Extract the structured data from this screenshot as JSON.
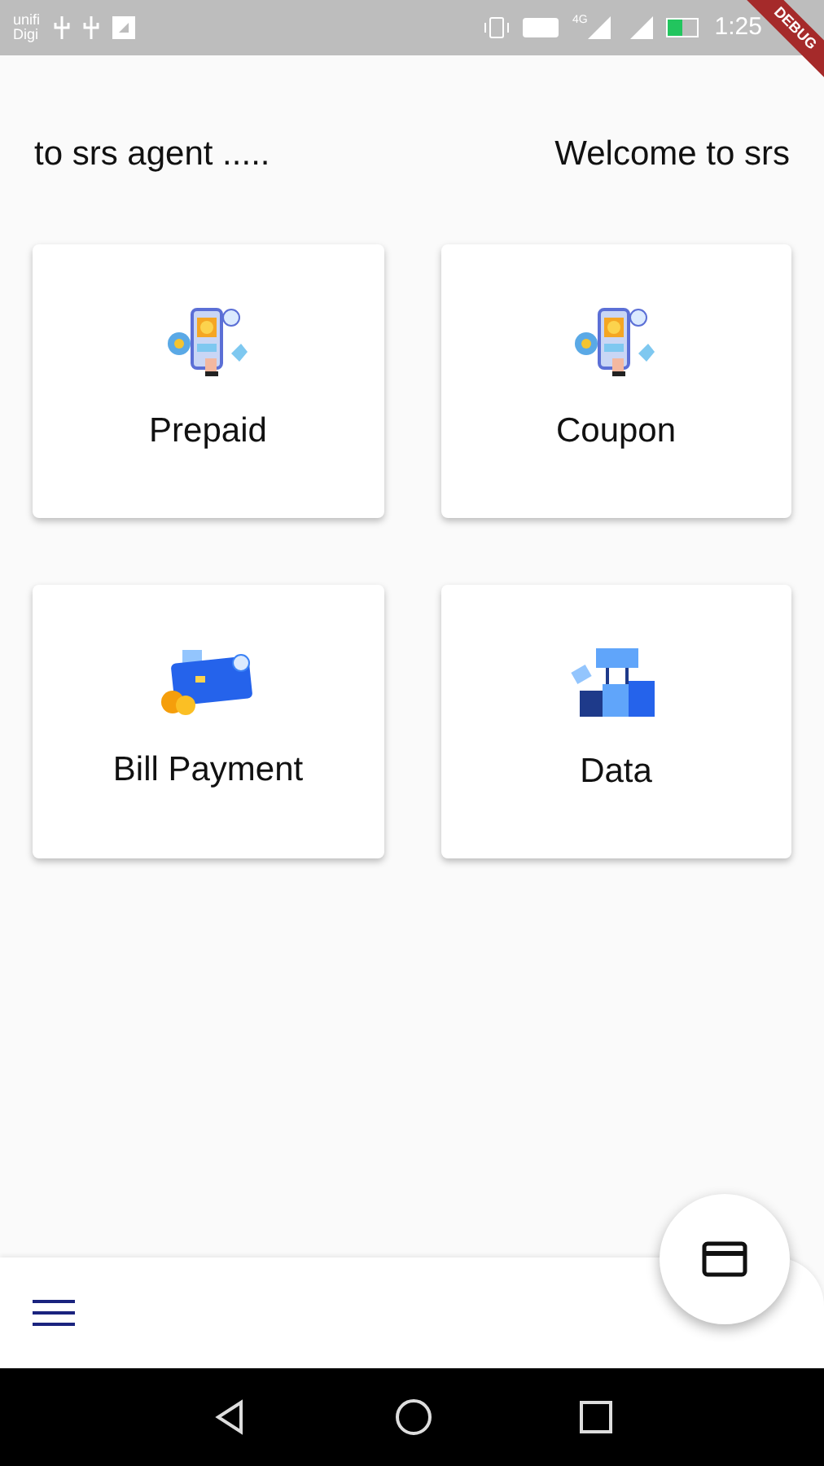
{
  "status_bar": {
    "carrier_top": "unifi",
    "carrier_bottom": "Digi",
    "network": "4G",
    "time": "1:25"
  },
  "debug_banner": "DEBUG",
  "header": {
    "left": "to srs agent .....",
    "right": "Welcome to srs"
  },
  "cards": [
    {
      "label": "Prepaid",
      "kind": "phone"
    },
    {
      "label": "Coupon",
      "kind": "phone"
    },
    {
      "label": "Bill Payment",
      "kind": "card"
    },
    {
      "label": "Data",
      "kind": "sale"
    }
  ]
}
